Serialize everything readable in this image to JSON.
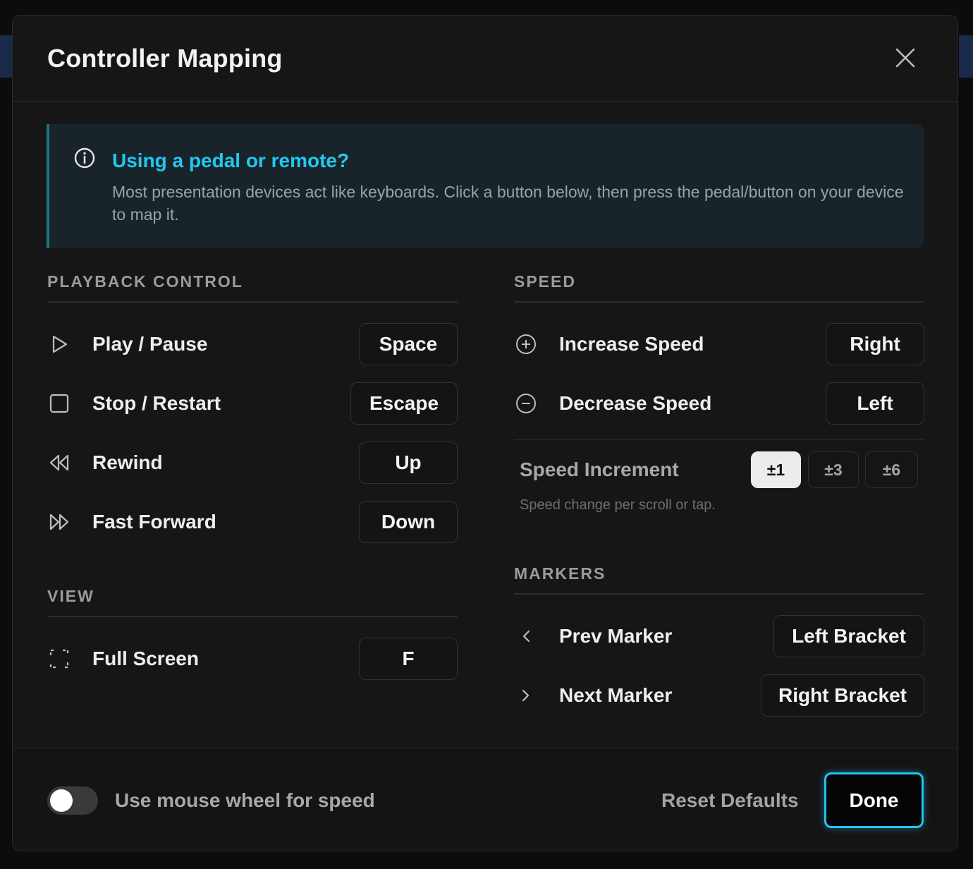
{
  "dialog": {
    "title": "Controller Mapping"
  },
  "info": {
    "title": "Using a pedal or remote?",
    "body": "Most presentation devices act like keyboards. Click a button below, then press the pedal/button on your device to map it."
  },
  "playback": {
    "heading": "PLAYBACK CONTROL",
    "rows": [
      {
        "label": "Play / Pause",
        "key": "Space",
        "icon": "play-icon"
      },
      {
        "label": "Stop / Restart",
        "key": "Escape",
        "icon": "stop-icon"
      },
      {
        "label": "Rewind",
        "key": "Up",
        "icon": "rewind-icon"
      },
      {
        "label": "Fast Forward",
        "key": "Down",
        "icon": "fast-forward-icon"
      }
    ]
  },
  "view": {
    "heading": "VIEW",
    "rows": [
      {
        "label": "Full Screen",
        "key": "F",
        "icon": "fullscreen-icon"
      }
    ]
  },
  "speed": {
    "heading": "SPEED",
    "rows": [
      {
        "label": "Increase Speed",
        "key": "Right",
        "icon": "plus-circle-icon"
      },
      {
        "label": "Decrease Speed",
        "key": "Left",
        "icon": "minus-circle-icon"
      }
    ],
    "increment_label": "Speed Increment",
    "increment_options": [
      "±1",
      "±3",
      "±6"
    ],
    "increment_selected": "±1",
    "increment_hint": "Speed change per scroll or tap."
  },
  "markers": {
    "heading": "MARKERS",
    "rows": [
      {
        "label": "Prev Marker",
        "key": "Left Bracket",
        "icon": "chevron-left-icon"
      },
      {
        "label": "Next Marker",
        "key": "Right Bracket",
        "icon": "chevron-right-icon"
      }
    ]
  },
  "footer": {
    "toggle_label": "Use mouse wheel for speed",
    "toggle_on": false,
    "reset_label": "Reset Defaults",
    "done_label": "Done"
  },
  "colors": {
    "accent": "#22c8f0",
    "info_bg": "#182429",
    "modal_bg": "#161617"
  }
}
